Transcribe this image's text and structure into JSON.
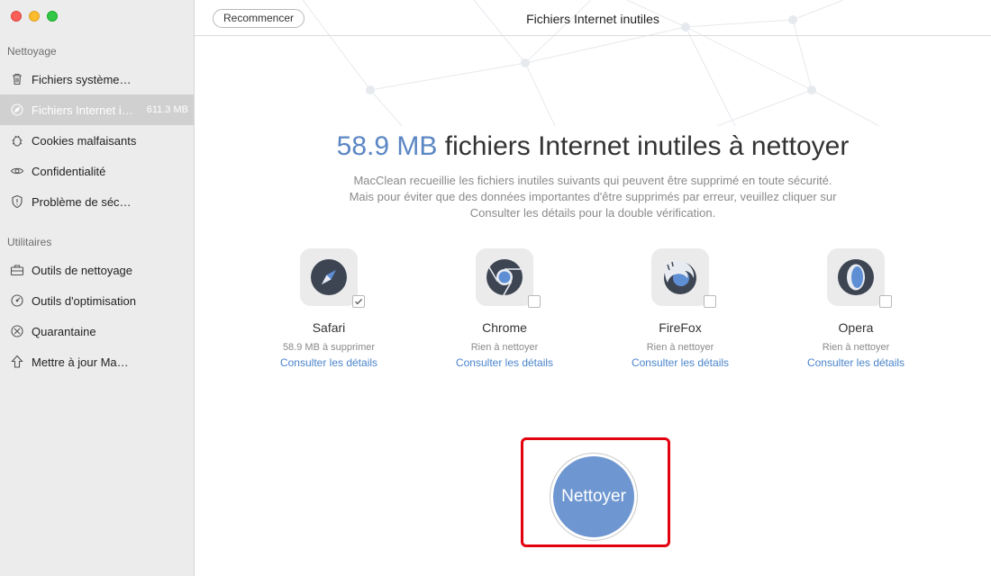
{
  "window": {
    "title": "Fichiers Internet inutiles",
    "restart_label": "Recommencer"
  },
  "sidebar": {
    "section_cleaning": "Nettoyage",
    "cleaning_items": [
      {
        "label": "Fichiers système…",
        "icon": "trash-icon"
      },
      {
        "label": "Fichiers Internet i…",
        "icon": "compass-icon",
        "size": "611.3 MB",
        "active": true
      },
      {
        "label": "Cookies malfaisants",
        "icon": "bug-icon"
      },
      {
        "label": "Confidentialité",
        "icon": "eye-icon"
      },
      {
        "label": "Problème de séc…",
        "icon": "shield-icon"
      }
    ],
    "section_utilities": "Utilitaires",
    "utility_items": [
      {
        "label": "Outils de nettoyage",
        "icon": "toolbox-icon"
      },
      {
        "label": "Outils d'optimisation",
        "icon": "gauge-icon"
      },
      {
        "label": "Quarantaine",
        "icon": "quarantine-icon"
      },
      {
        "label": "Mettre à jour Ma…",
        "icon": "upload-arrow-icon"
      }
    ]
  },
  "main": {
    "headline_amount": "58.9 MB",
    "headline_rest": " fichiers Internet inutiles à nettoyer",
    "description": "MacClean recueillie les fichiers inutiles suivants qui peuvent être supprimé en toute sécurité. Mais pour éviter que des données importantes d'être supprimés par erreur, veuillez cliquer sur Consulter les détails pour la double vérification.",
    "browsers": [
      {
        "name": "Safari",
        "status": "58.9 MB à supprimer",
        "link": "Consulter les détails",
        "checked": true,
        "icon": "safari-icon"
      },
      {
        "name": "Chrome",
        "status": "Rien à nettoyer",
        "link": "Consulter les détails",
        "checked": false,
        "icon": "chrome-icon"
      },
      {
        "name": "FireFox",
        "status": "Rien à nettoyer",
        "link": "Consulter les détails",
        "checked": false,
        "icon": "firefox-icon"
      },
      {
        "name": "Opera",
        "status": "Rien à nettoyer",
        "link": "Consulter les détails",
        "checked": false,
        "icon": "opera-icon"
      }
    ],
    "clean_button": "Nettoyer"
  },
  "colors": {
    "accent": "#5b86c4",
    "clean_button": "#6e96d0",
    "highlight_border": "#e3000f",
    "link": "#4a84cc"
  }
}
